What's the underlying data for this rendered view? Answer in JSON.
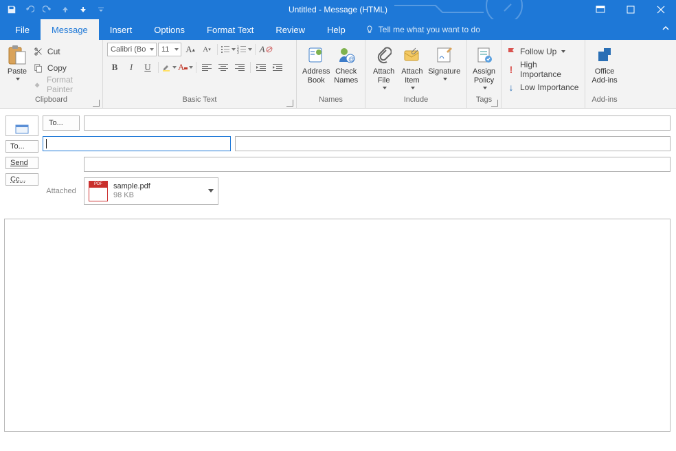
{
  "window": {
    "title": "Untitled  -  Message (HTML)"
  },
  "qat": {
    "save": "save-icon",
    "undo": "undo-icon",
    "redo": "redo-icon",
    "up": "up-icon",
    "down": "down-icon",
    "more": "more-icon"
  },
  "tabs": {
    "file": "File",
    "message": "Message",
    "insert": "Insert",
    "options": "Options",
    "format_text": "Format Text",
    "review": "Review",
    "help": "Help",
    "tell_me": "Tell me what you want to do"
  },
  "ribbon": {
    "clipboard": {
      "label": "Clipboard",
      "paste": "Paste",
      "cut": "Cut",
      "copy": "Copy",
      "format_painter": "Format Painter"
    },
    "basic_text": {
      "label": "Basic Text",
      "font_name": "Calibri (Bo",
      "font_size": "11"
    },
    "names": {
      "label": "Names",
      "address_book": "Address\nBook",
      "check_names": "Check\nNames"
    },
    "include": {
      "label": "Include",
      "attach_file": "Attach\nFile",
      "attach_item": "Attach\nItem",
      "signature": "Signature"
    },
    "assign_policy": {
      "label": "Assign\nPolicy"
    },
    "tags": {
      "label": "Tags",
      "follow_up": "Follow Up",
      "high_importance": "High Importance",
      "low_importance": "Low Importance"
    },
    "addins": {
      "label": "Add-ins",
      "office_addins": "Office\nAdd-ins"
    }
  },
  "compose": {
    "to_btn": "To...",
    "cc_btn": "Cc...",
    "to_small": "To...",
    "send": "Send",
    "attached_label": "Attached",
    "attachment": {
      "name": "sample.pdf",
      "size": "98 KB"
    }
  }
}
